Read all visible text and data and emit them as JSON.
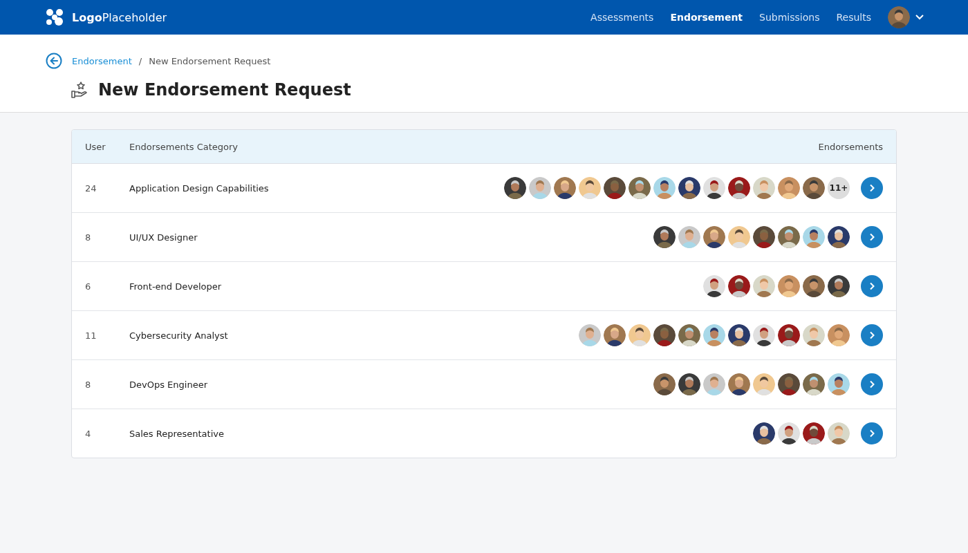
{
  "header": {
    "logo": "**Logo**Placeholder",
    "nav": [
      {
        "label": "Assessments",
        "selected": false
      },
      {
        "label": "Endorsement",
        "selected": true
      },
      {
        "label": "Submissions",
        "selected": false
      },
      {
        "label": "Results",
        "selected": false
      }
    ]
  },
  "breadcrumb": [
    {
      "label": "Endorsement",
      "kind": "link"
    },
    {
      "label": "/",
      "kind": "separator"
    },
    {
      "label": "New Endorsement Request",
      "kind": "current"
    }
  ],
  "page_title": "New Endorsement Request",
  "table": {
    "columns": [
      "User",
      "Endorsements Category",
      "Endorsements"
    ],
    "rows": [
      {
        "user": "24",
        "category": "Application Design Capabilities",
        "more": "11+"
      },
      {
        "user": "8",
        "category": "UI/UX Designer"
      },
      {
        "user": "6",
        "category": "Front-end Developer"
      },
      {
        "user": "11",
        "category": "Cybersecurity Analyst"
      },
      {
        "user": "8",
        "category": "DevOps Engineer"
      },
      {
        "user": "4",
        "category": "Sales Representative"
      }
    ]
  }
}
